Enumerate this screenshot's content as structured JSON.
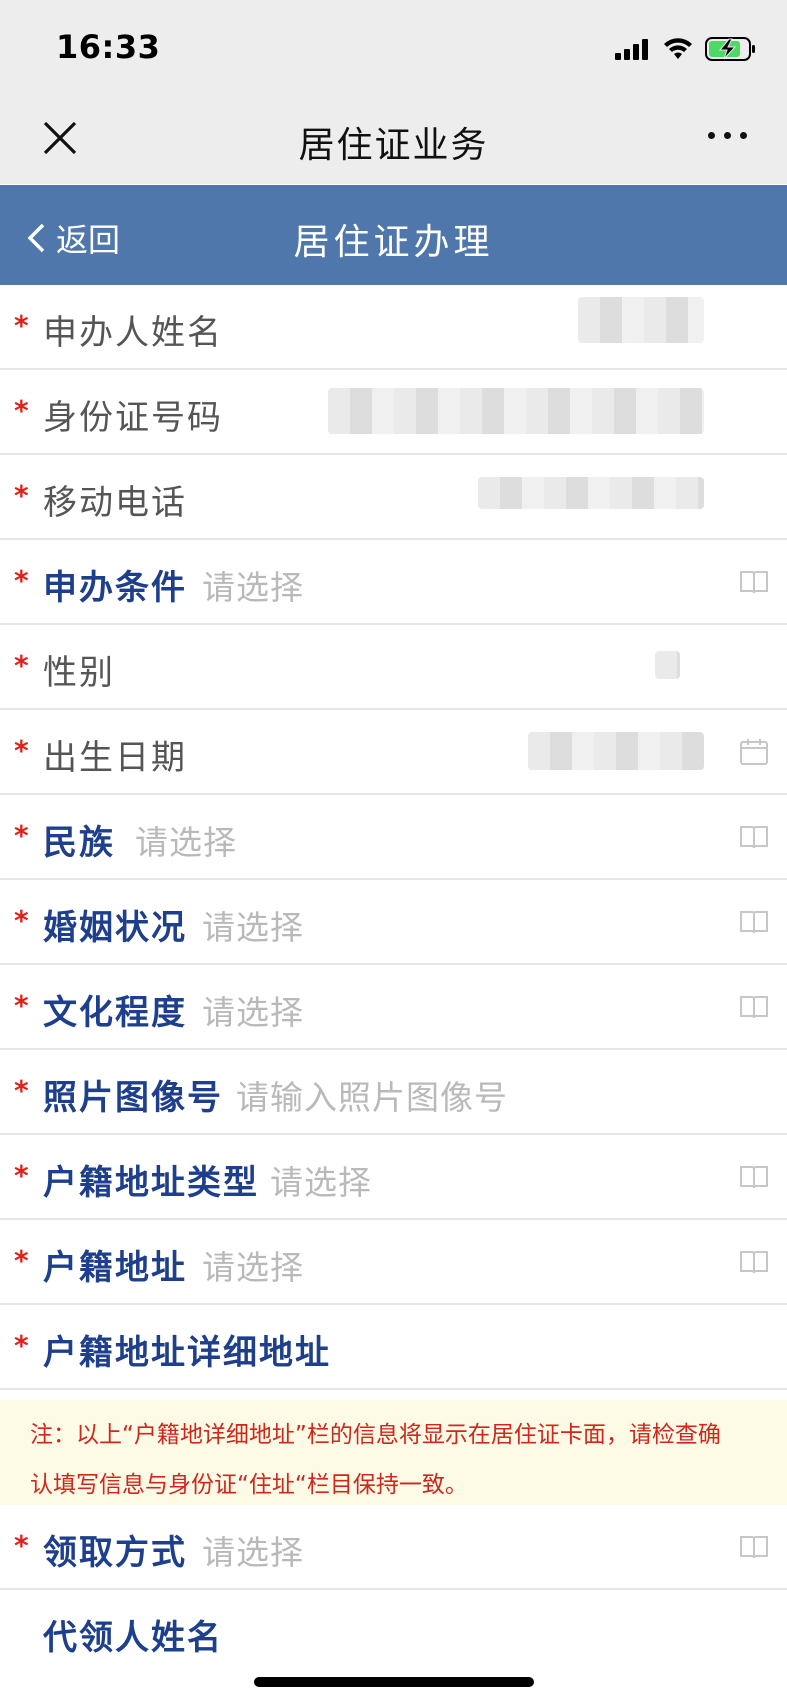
{
  "status_bar": {
    "time": "16:33"
  },
  "wechat_bar": {
    "title": "居住证业务"
  },
  "nav": {
    "back_label": "返回",
    "title": "居住证办理"
  },
  "form": {
    "rows": [
      {
        "label": "申办人姓名",
        "required": "*",
        "value": ""
      },
      {
        "label": "身份证号码",
        "required": "*",
        "value": ""
      },
      {
        "label": "移动电话",
        "required": "*",
        "value": ""
      },
      {
        "label": "申办条件",
        "required": "*",
        "placeholder": "请选择"
      },
      {
        "label": "性别",
        "required": "*",
        "value": ""
      },
      {
        "label": "出生日期",
        "required": "*",
        "value": ""
      },
      {
        "label": "民族",
        "required": "*",
        "placeholder": "请选择"
      },
      {
        "label": "婚姻状况",
        "required": "*",
        "placeholder": "请选择"
      },
      {
        "label": "文化程度",
        "required": "*",
        "placeholder": "请选择"
      },
      {
        "label": "照片图像号",
        "required": "*",
        "placeholder": "请输入照片图像号"
      },
      {
        "label": "户籍地址类型",
        "required": "*",
        "placeholder": "请选择"
      },
      {
        "label": "户籍地址",
        "required": "*",
        "placeholder": "请选择"
      },
      {
        "label": "户籍地址详细地址",
        "required": "*"
      }
    ],
    "notice": {
      "line1": "注：以上“户籍地详细地址”栏的信息将显示在居住证卡面，请检查确",
      "line2": "认填写信息与身份证“住址“栏目保持一致。"
    },
    "rows2": [
      {
        "label": "领取方式",
        "required": "*",
        "placeholder": "请选择"
      },
      {
        "label": "代领人姓名"
      }
    ]
  },
  "colors": {
    "nav_bg": "#4f77ab",
    "label_blue": "#1e3f8c",
    "required_red": "#e0211a",
    "notice_bg": "#fdfbe6",
    "notice_text": "#d0271d"
  },
  "icons": {
    "close": "close-icon",
    "more": "more-icon",
    "back": "chevron-left-icon",
    "book": "book-icon",
    "calendar": "calendar-icon",
    "signal": "signal-icon",
    "wifi": "wifi-icon",
    "battery": "battery-charging-icon"
  }
}
